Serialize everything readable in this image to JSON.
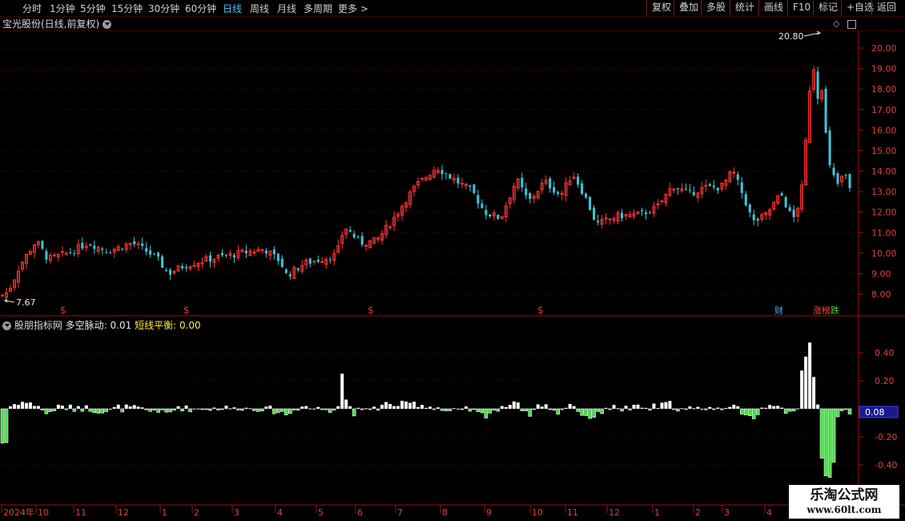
{
  "toolbar": {
    "left": [
      "分时",
      "1分钟",
      "5分钟",
      "15分钟",
      "30分钟",
      "60分钟",
      "日线",
      "周线",
      "月线",
      "多周期",
      "更多 >"
    ],
    "active": "日线",
    "right": [
      "复权",
      "叠加",
      "多股",
      "统计",
      "画线",
      "F10",
      "标记",
      "+自选",
      "返回"
    ]
  },
  "main": {
    "title": "宝光股份(日线,前复权)",
    "y_ticks": [
      "20.00",
      "19.00",
      "18.00",
      "17.00",
      "16.00",
      "15.00",
      "14.00",
      "13.00",
      "12.00",
      "11.00",
      "10.00",
      "9.00",
      "8.00"
    ],
    "high_label": "20.80",
    "low_label": "7.67",
    "markers": [
      {
        "text": "$",
        "color": "#e03030"
      },
      {
        "text": "$",
        "color": "#e03030"
      },
      {
        "text": "$",
        "color": "#e03030"
      },
      {
        "text": "$",
        "color": "#e03030"
      }
    ],
    "badges": [
      {
        "text": "财",
        "color": "#4fa3ff"
      },
      {
        "text": "涨榜",
        "color": "#ff4040"
      },
      {
        "text": "跌",
        "color": "#40d040"
      }
    ]
  },
  "indicator": {
    "source": "股朋指标网",
    "line1_label": "多空脉动:",
    "line1_value": "0.01",
    "line2_label": "短线平衡:",
    "line2_value": "0.00",
    "y_ticks": [
      "0.40",
      "0.20",
      "-0.20",
      "-0.40"
    ],
    "current_value": "0.08"
  },
  "x_axis": [
    "2024年",
    "10",
    "11",
    "12",
    "1",
    "2",
    "3",
    "4",
    "5",
    "6",
    "7",
    "8",
    "9",
    "10",
    "11",
    "12",
    "1",
    "2",
    "3",
    "4"
  ],
  "watermark": {
    "line1": "乐淘公式网",
    "line2": "www.60lt.com"
  },
  "colors": {
    "up": "#ff3333",
    "down": "#3ec8d8",
    "grid": "#6a0000",
    "ind_pos": "#ffffff",
    "ind_neg": "#40e040"
  },
  "chart_data": {
    "type": "candlestick",
    "price_range": [
      7.6,
      20.9
    ],
    "indicator_range": [
      -0.5,
      0.5
    ]
  }
}
